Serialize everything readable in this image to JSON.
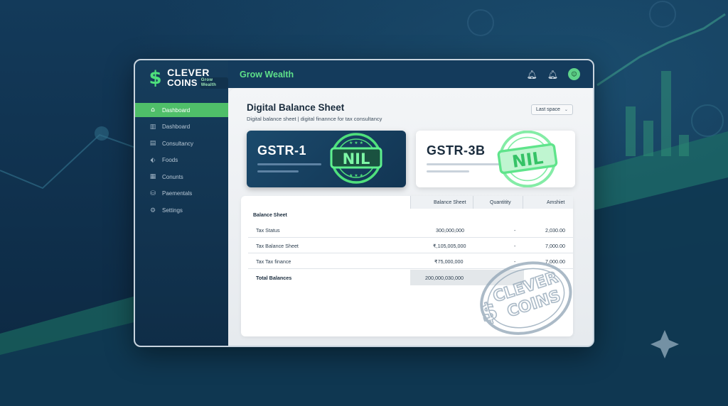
{
  "brand": {
    "line1": "CLEVER",
    "line2": "COINS",
    "tagline": "Grow Wealth",
    "colors": {
      "accent": "#4fbf69",
      "navy": "#143b5c",
      "green": "#5ee08a"
    }
  },
  "topbar": {
    "title": "Grow Wealth",
    "icons": [
      "bell-icon",
      "bell-icon",
      "avatar-icon"
    ]
  },
  "sidebar": {
    "items": [
      {
        "label": "Dashboard",
        "icon": "home-icon",
        "active": true
      },
      {
        "label": "Dashboard",
        "icon": "bar-chart-icon",
        "active": false
      },
      {
        "label": "Consultancy",
        "icon": "document-icon",
        "active": false
      },
      {
        "label": "Foods",
        "icon": "tag-icon",
        "active": false
      },
      {
        "label": "Conunts",
        "icon": "buildings-icon",
        "active": false
      },
      {
        "label": "Paementals",
        "icon": "coins-icon",
        "active": false
      },
      {
        "label": "Settings",
        "icon": "gear-icon",
        "active": false
      }
    ]
  },
  "page": {
    "title": "Digital Balance Sheet",
    "subtitle": "Digital balance sheet | digital finannce for tax consultancy",
    "dropdown": "Last space"
  },
  "cards": [
    {
      "title": "GSTR-1",
      "stamp": "NIL"
    },
    {
      "title": "GSTR-3B",
      "stamp": "NIL"
    }
  ],
  "table": {
    "headers": [
      "Balance Sheet",
      "Quantitity",
      "Amshiet"
    ],
    "section": "Balance Sheet",
    "rows": [
      {
        "name": "Tax Status",
        "balance": "300,000,000",
        "qty": "-",
        "amount": "2,030.00"
      },
      {
        "name": "Tax Balance Sheet",
        "balance": "₹,105,005,000",
        "qty": "-",
        "amount": "7,000.00"
      },
      {
        "name": "Tax Tax finance",
        "balance": "₹75,000,000",
        "qty": "-",
        "amount": "7,000.00"
      }
    ],
    "total": {
      "name": "Total Balances",
      "balance": "200,000,030,000"
    }
  },
  "watermark": {
    "line1": "CLEVER",
    "line2": "COINS"
  }
}
